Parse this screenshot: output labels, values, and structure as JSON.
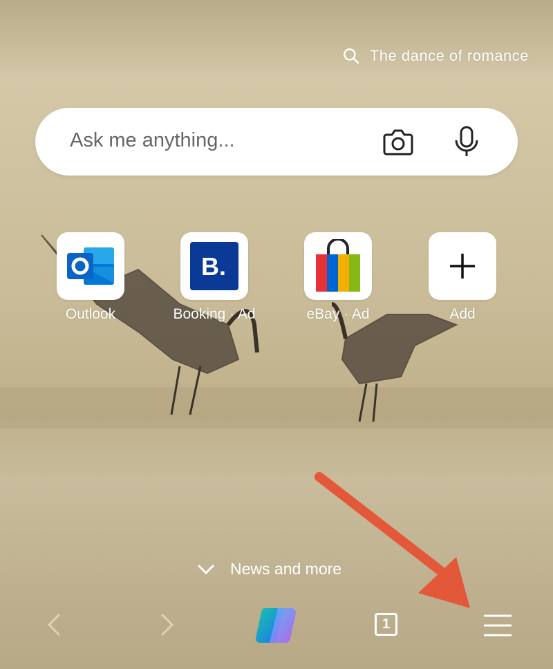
{
  "background": {
    "caption": "The dance of romance"
  },
  "search": {
    "placeholder": "Ask me anything..."
  },
  "quick_links": [
    {
      "label": "Outlook"
    },
    {
      "label": "Booking · Ad"
    },
    {
      "label": "eBay · Ad"
    },
    {
      "label": "Add"
    }
  ],
  "news": {
    "label": "News and more"
  },
  "toolbar": {
    "tab_count": "1"
  },
  "colors": {
    "annotation_arrow": "#e4583a",
    "outlook_blue": "#0a64c8",
    "booking_blue": "#0a3a96"
  }
}
